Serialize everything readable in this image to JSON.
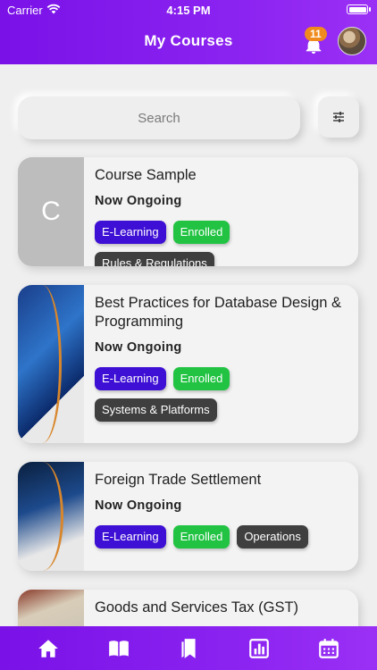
{
  "status_bar": {
    "carrier": "Carrier",
    "time": "4:15 PM"
  },
  "header": {
    "title": "My Courses",
    "notification_count": "11"
  },
  "search": {
    "placeholder": "Search"
  },
  "courses": [
    {
      "thumb_letter": "C",
      "title": "Course Sample",
      "status": "Now Ongoing",
      "tags": [
        "E-Learning",
        "Enrolled",
        "Rules & Regulations"
      ]
    },
    {
      "title": "Best Practices for Database Design & Programming",
      "status": "Now Ongoing",
      "tags": [
        "E-Learning",
        "Enrolled",
        "Systems & Platforms"
      ]
    },
    {
      "title": "Foreign Trade Settlement",
      "status": "Now Ongoing",
      "tags": [
        "E-Learning",
        "Enrolled",
        "Operations"
      ]
    },
    {
      "title": "Goods and Services Tax (GST)"
    }
  ],
  "tabbar": {
    "icons": [
      "home-icon",
      "book-icon",
      "bookmark-icon",
      "bar-chart-icon",
      "calendar-icon"
    ]
  },
  "colors": {
    "header_gradient_start": "#7a12e8",
    "header_gradient_end": "#9b30f5",
    "tag_elearning": "#3e0fd4",
    "tag_enrolled": "#22c343",
    "tag_category": "#3f3f3f",
    "badge": "#f08a1c"
  }
}
